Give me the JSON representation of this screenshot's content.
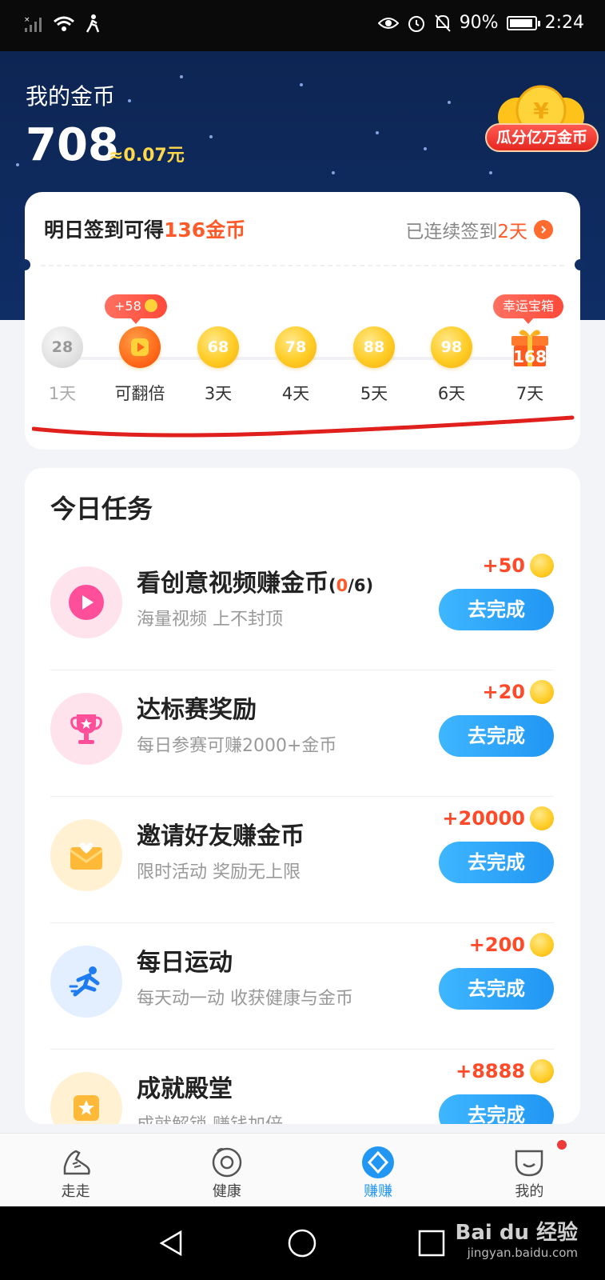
{
  "status_bar": {
    "battery": "90%",
    "time": "2:24"
  },
  "header": {
    "coins_label": "我的金币",
    "coins_value": "708",
    "coins_yuan": "≈0.07元",
    "promo_badge": "瓜分亿万金币"
  },
  "signin": {
    "title_prefix": "明日签到可得",
    "title_amount": "136金币",
    "streak_prefix": "已连续签到",
    "streak_days": "2天",
    "days": [
      {
        "coin": "28",
        "label": "1天",
        "state": "done"
      },
      {
        "coin": "",
        "label": "可翻倍",
        "state": "play",
        "tip": "+58"
      },
      {
        "coin": "68",
        "label": "3天",
        "state": "pending"
      },
      {
        "coin": "78",
        "label": "4天",
        "state": "pending"
      },
      {
        "coin": "88",
        "label": "5天",
        "state": "pending"
      },
      {
        "coin": "98",
        "label": "6天",
        "state": "pending"
      },
      {
        "coin": "168",
        "label": "7天",
        "state": "gift",
        "tip": "幸运宝箱"
      }
    ]
  },
  "tasks": {
    "title": "今日任务",
    "items": [
      {
        "name": "看创意视频赚金币",
        "progress_open": "(",
        "progress_done": "0",
        "progress_total": "/6)",
        "desc": "海量视频 上不封顶",
        "reward": "+50",
        "button": "去完成",
        "icon": "play-icon"
      },
      {
        "name": "达标赛奖励",
        "desc": "每日参赛可赚2000+金币",
        "reward": "+20",
        "button": "去完成",
        "icon": "trophy-icon"
      },
      {
        "name": "邀请好友赚金币",
        "desc": "限时活动 奖励无上限",
        "reward": "+20000",
        "button": "去完成",
        "icon": "envelope-heart-icon"
      },
      {
        "name": "每日运动",
        "desc": "每天动一动 收获健康与金币",
        "reward": "+200",
        "button": "去完成",
        "icon": "runner-icon"
      },
      {
        "name": "成就殿堂",
        "desc": "成就解锁 赚钱加倍",
        "reward": "+8888",
        "button": "去完成",
        "icon": "star-badge-icon"
      }
    ]
  },
  "tabbar": {
    "tabs": [
      {
        "label": "走走",
        "icon": "shoe-icon"
      },
      {
        "label": "健康",
        "icon": "health-icon"
      },
      {
        "label": "赚赚",
        "icon": "earn-icon",
        "active": true
      },
      {
        "label": "我的",
        "icon": "profile-icon"
      }
    ]
  },
  "watermark": {
    "brand": "Bai du 经验",
    "url": "jingyan.baidu.com"
  },
  "colors": {
    "header_bg": "#0f2e66",
    "accent_orange": "#ff5a2a",
    "button_blue": "#2196f3",
    "coin_gold": "#ffcc24"
  }
}
